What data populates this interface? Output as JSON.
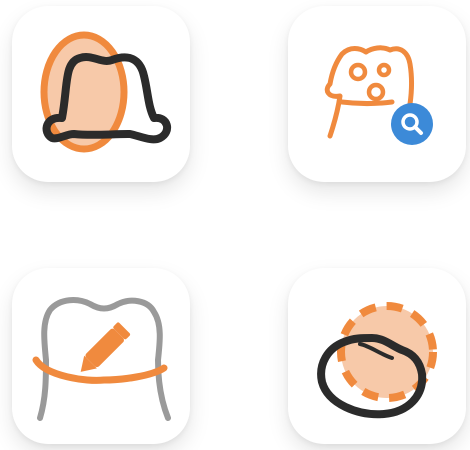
{
  "colors": {
    "accent_orange": "#F08A3E",
    "peach_fill": "#F7C9A9",
    "outline_dark": "#2B2B2B",
    "outline_gray": "#9A9A9A",
    "search_blue": "#3C8AD8",
    "tile_background": "#FFFFFF"
  },
  "tiles": [
    {
      "icon": "tooth-crown-oval-icon"
    },
    {
      "icon": "tooth-cavity-search-icon"
    },
    {
      "icon": "tooth-edit-pencil-icon"
    },
    {
      "icon": "tooth-scan-dashed-circle-icon"
    }
  ]
}
